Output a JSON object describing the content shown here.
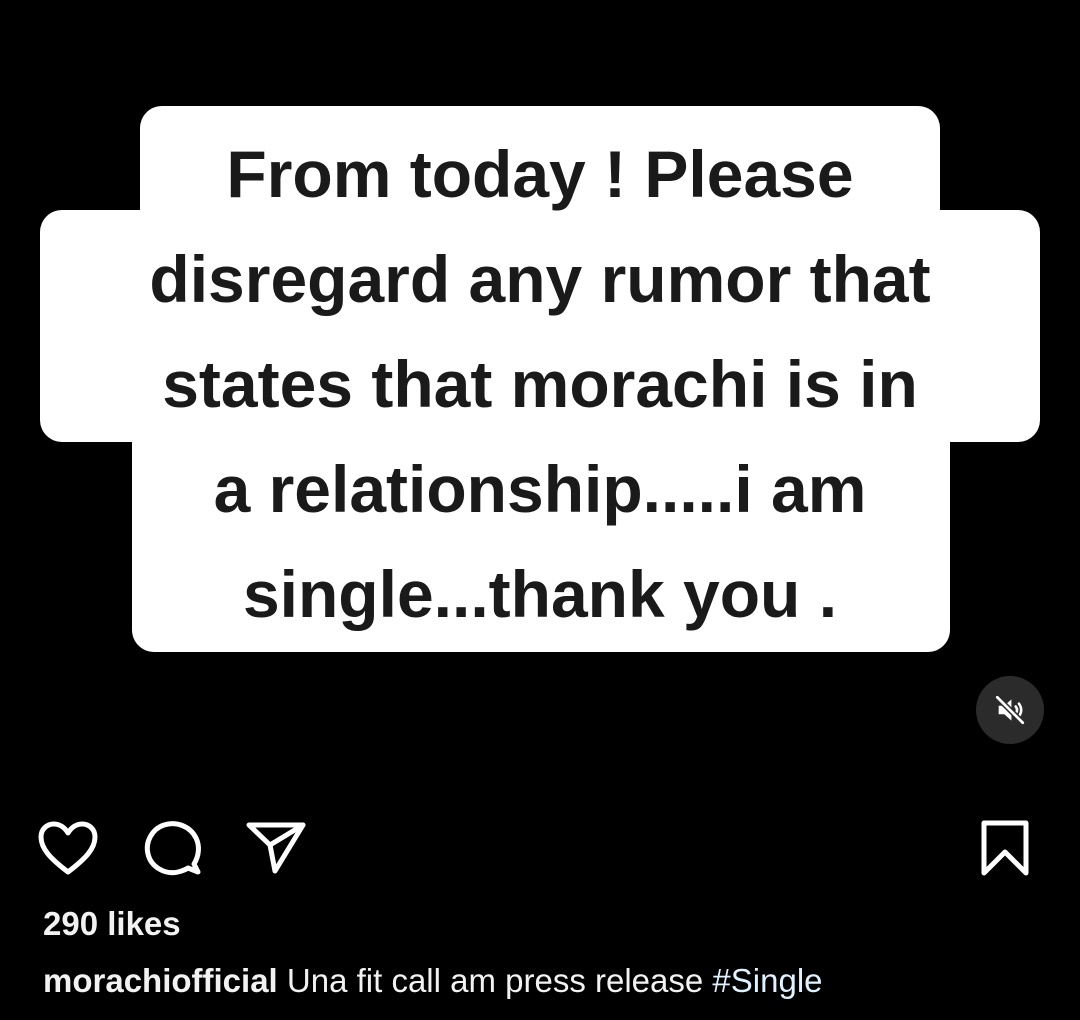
{
  "post": {
    "media": {
      "caption_lines": [
        "From today ! Please",
        "disregard any rumor that",
        "states that morachi is in",
        "a relationship.....i am",
        "single...thank you ."
      ],
      "caption_card_color": "#ffffff",
      "caption_text_color": "#1a1a1a",
      "mute_icon": "speaker-muted-icon"
    },
    "actions": {
      "like_icon": "heart-icon",
      "comment_icon": "comment-bubble-icon",
      "share_icon": "paper-plane-icon",
      "save_icon": "bookmark-icon"
    },
    "likes_text": "290 likes",
    "caption": {
      "username": "morachiofficial",
      "text": "Una fit call am press release",
      "hashtag": "#Single"
    }
  },
  "colors": {
    "background": "#000000",
    "text": "#f2f2f2",
    "hashtag": "#e0f1ff",
    "mute_button_bg": "#2b2b2b"
  }
}
